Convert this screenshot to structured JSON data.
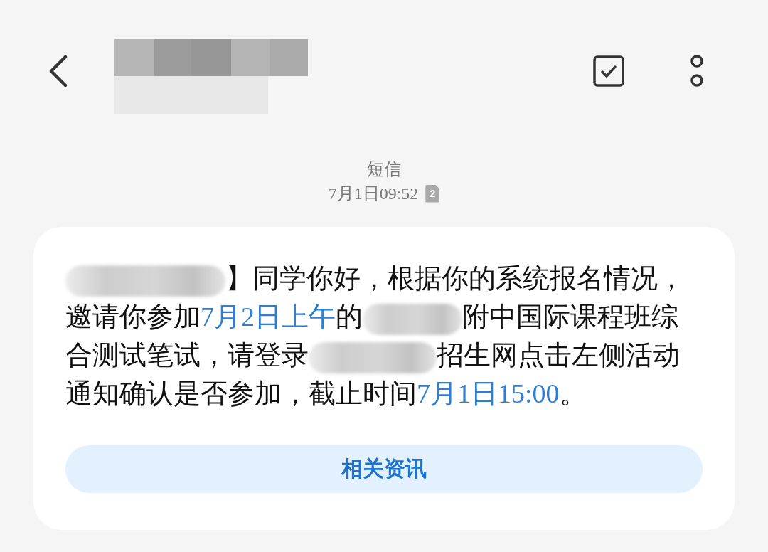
{
  "thread": {
    "channel": "短信",
    "timestamp": "7月1日09:52",
    "sim": "2"
  },
  "message": {
    "segments": [
      {
        "kind": "redacted"
      },
      {
        "kind": "text",
        "text": "】同学你好，根据你的系统报名情况，邀请你参加"
      },
      {
        "kind": "link",
        "text": "7月2日上午"
      },
      {
        "kind": "text",
        "text": "的"
      },
      {
        "kind": "redacted"
      },
      {
        "kind": "text",
        "text": "附中国际课程班综合测试笔试，请登录"
      },
      {
        "kind": "redacted"
      },
      {
        "kind": "text",
        "text": "招生网点击左侧活动通知确认是否参加，截止时间"
      },
      {
        "kind": "link",
        "text": "7月1日15:00"
      },
      {
        "kind": "text",
        "text": "。"
      }
    ],
    "action": "相关资讯"
  }
}
